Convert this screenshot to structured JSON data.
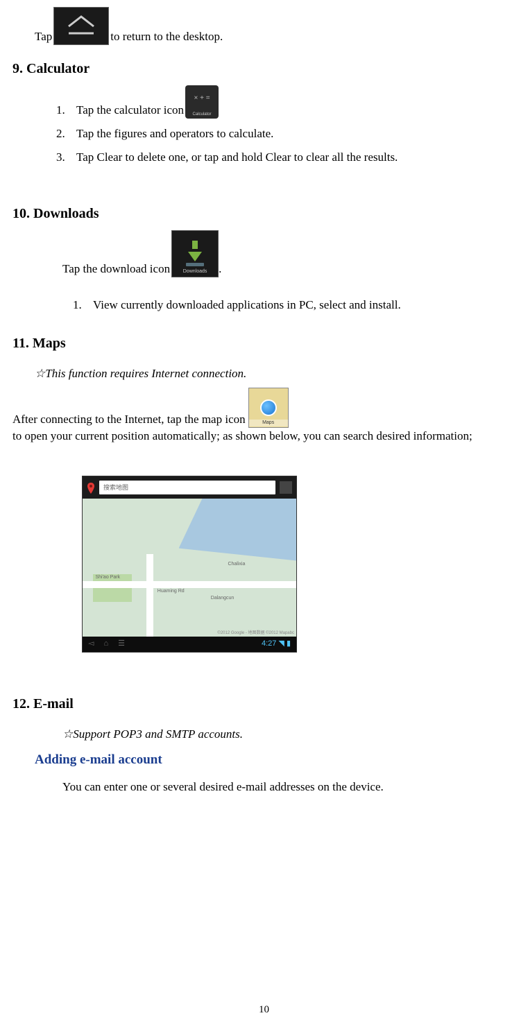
{
  "intro": {
    "tap": "Tap ",
    "return_desktop": "to return to the desktop."
  },
  "sec9": {
    "heading": "9. Calculator",
    "items": {
      "i1_pre": "Tap the calculator icon",
      "i2": "Tap the figures and operators to calculate.",
      "i3": "Tap Clear to delete one, or tap and hold Clear to clear all the results."
    }
  },
  "sec10": {
    "heading": "10. Downloads",
    "text_pre": "Tap the download icon",
    "text_post": ".",
    "nested": {
      "i1": "View currently downloaded applications in PC, select and install."
    }
  },
  "sec11": {
    "heading": "11. Maps",
    "note": "☆This function requires Internet connection.",
    "line_pre": "After connecting to the Internet, tap the map icon ",
    "line_post": "to open your current position automatically; as shown below, you can search desired information;"
  },
  "sec12": {
    "heading": "12. E-mail",
    "note": "☆Support POP3 and SMTP accounts.",
    "sub_heading": "Adding e-mail account",
    "body": "You can enter one or several desired e-mail addresses on the device."
  },
  "map_screenshot": {
    "search_placeholder": "搜索地图",
    "park_label": "Shi'ao Park",
    "road_label": "Huaming Rd",
    "village_label": "Dalangcun",
    "area_label": "Chalixia",
    "copyright": "©2012 Google - 地图数据 ©2012 Mapabc",
    "time": "4:27"
  },
  "page_number": "10"
}
